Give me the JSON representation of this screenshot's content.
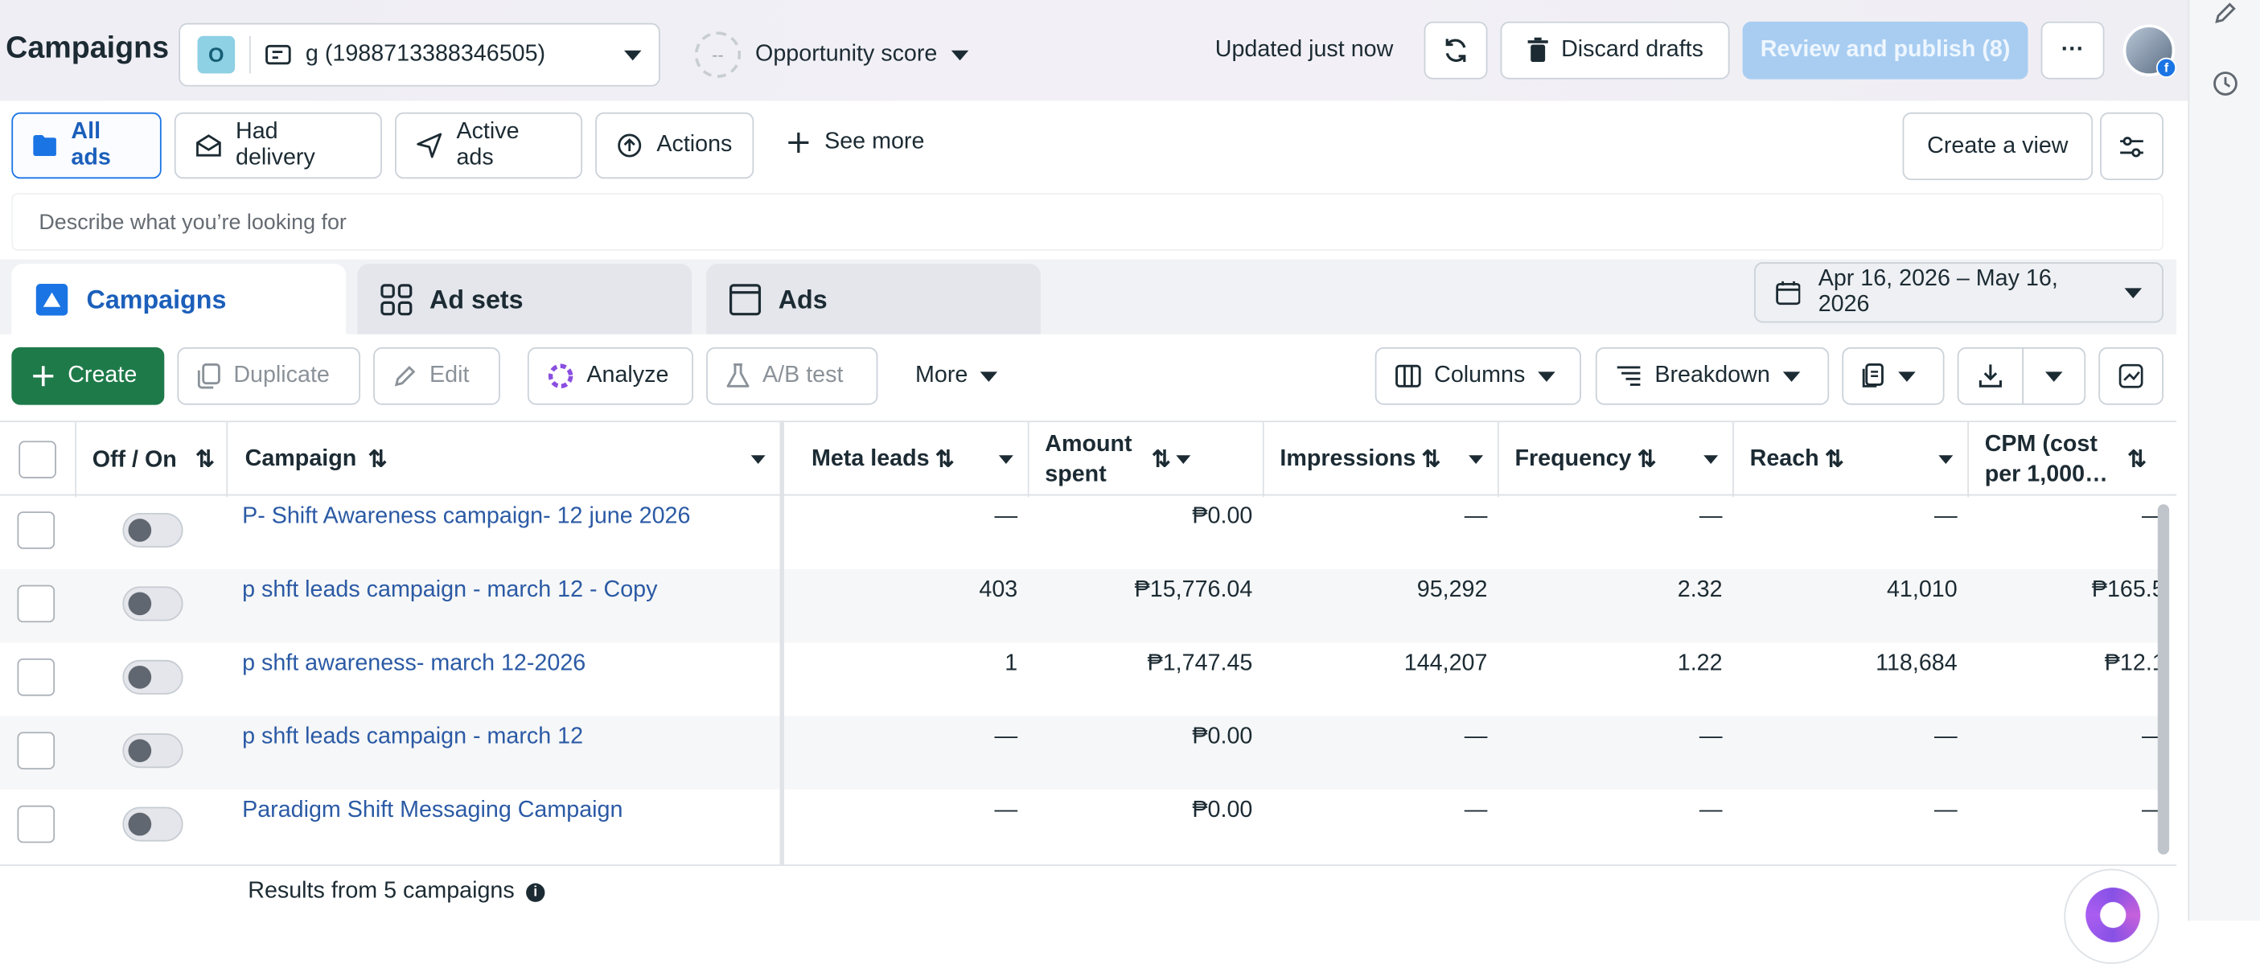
{
  "header": {
    "title": "Campaigns",
    "account": {
      "badge": "O",
      "label": "g (1988713388346505)"
    },
    "opportunity": {
      "score_placeholder": "--",
      "label": "Opportunity score"
    },
    "updated": "Updated just now",
    "discard_label": "Discard drafts",
    "publish_label": "Review and publish (8)",
    "more_label": "···"
  },
  "filters": {
    "items": [
      {
        "label": "All ads"
      },
      {
        "label": "Had delivery"
      },
      {
        "label": "Active ads"
      },
      {
        "label": "Actions"
      }
    ],
    "see_more": "See more",
    "create_view": "Create a view"
  },
  "search": {
    "placeholder": "Describe what you’re looking for"
  },
  "tabs": [
    {
      "label": "Campaigns"
    },
    {
      "label": "Ad sets"
    },
    {
      "label": "Ads"
    }
  ],
  "date_range": "Apr 16, 2026 – May 16, 2026",
  "toolbar": {
    "create": "Create",
    "duplicate": "Duplicate",
    "edit": "Edit",
    "analyze": "Analyze",
    "ab_test": "A/B test",
    "more": "More",
    "columns": "Columns",
    "breakdown": "Breakdown"
  },
  "table": {
    "columns": {
      "off_on": "Off / On",
      "campaign": "Campaign",
      "meta_leads": "Meta leads",
      "amount_spent": "Amount spent",
      "impressions": "Impressions",
      "frequency": "Frequency",
      "reach": "Reach",
      "cpm": "CPM (cost per 1,000…"
    },
    "sort_glyph": "⇅",
    "rows": [
      {
        "campaign": "P- Shift Awareness campaign- 12 june 2026",
        "meta_leads": "—",
        "amount_spent": "₱0.00",
        "impressions": "—",
        "frequency": "—",
        "reach": "—",
        "cpm": "—"
      },
      {
        "campaign": "p shft leads campaign - march 12 - Copy",
        "meta_leads": "403",
        "amount_spent": "₱15,776.04",
        "impressions": "95,292",
        "frequency": "2.32",
        "reach": "41,010",
        "cpm": "₱165.5"
      },
      {
        "campaign": "p shft awareness- march 12-2026",
        "meta_leads": "1",
        "amount_spent": "₱1,747.45",
        "impressions": "144,207",
        "frequency": "1.22",
        "reach": "118,684",
        "cpm": "₱12.1"
      },
      {
        "campaign": "p shft leads campaign - march 12",
        "meta_leads": "—",
        "amount_spent": "₱0.00",
        "impressions": "—",
        "frequency": "—",
        "reach": "—",
        "cpm": "—"
      },
      {
        "campaign": "Paradigm Shift Messaging Campaign",
        "meta_leads": "—",
        "amount_spent": "₱0.00",
        "impressions": "—",
        "frequency": "—",
        "reach": "—",
        "cpm": "—"
      }
    ],
    "footer": "Results from 5 campaigns"
  },
  "colors": {
    "accent": "#1b74e4",
    "create_green": "#1f7a4a",
    "link": "#2b5aa5"
  }
}
